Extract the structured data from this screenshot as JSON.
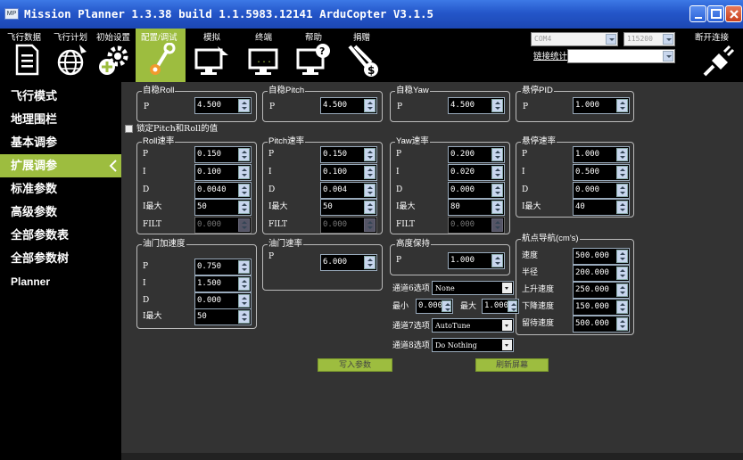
{
  "window": {
    "title": "Mission Planner 1.3.38 build 1.1.5983.12141 ArduCopter V3.1.5",
    "icon_label": "MP"
  },
  "toolbar": {
    "items": [
      {
        "label": "飞行数据",
        "icon": "flight-data-icon"
      },
      {
        "label": "飞行计划",
        "icon": "flight-plan-icon"
      },
      {
        "label": "初始设置",
        "icon": "initial-setup-icon"
      },
      {
        "label": "配置/调试",
        "icon": "config-tuning-icon"
      },
      {
        "label": "模拟",
        "icon": "simulation-icon"
      },
      {
        "label": "终端",
        "icon": "terminal-icon"
      },
      {
        "label": "帮助",
        "icon": "help-icon"
      },
      {
        "label": "捐赠",
        "icon": "donate-icon"
      }
    ],
    "port": "COM4",
    "baud": "115200",
    "link_stats": "链接统计",
    "connect_label": "断开连接"
  },
  "sidebar": {
    "items": [
      "飞行模式",
      "地理围栏",
      "基本调参",
      "扩展调参",
      "标准参数",
      "高级参数",
      "全部参数表",
      "全部参数树",
      "Planner"
    ],
    "active_index": 3
  },
  "groups": {
    "stab_roll": {
      "title": "自稳Roll",
      "p_label": "P",
      "p": "4.500"
    },
    "stab_pitch": {
      "title": "自稳Pitch",
      "p_label": "P",
      "p": "4.500"
    },
    "stab_yaw": {
      "title": "自稳Yaw",
      "p_label": "P",
      "p": "4.500"
    },
    "loiter_pid": {
      "title": "悬停PID",
      "p_label": "P",
      "p": "1.000"
    },
    "lock_checkbox": "锁定Pitch和Roll的值",
    "rate_roll": {
      "title": "Roll速率",
      "labels": [
        "P",
        "I",
        "D",
        "I最大",
        "FILT"
      ],
      "values": [
        "0.150",
        "0.100",
        "0.0040",
        "50",
        "0.000"
      ]
    },
    "rate_pitch": {
      "title": "Pitch速率",
      "labels": [
        "P",
        "I",
        "D",
        "I最大",
        "FILT"
      ],
      "values": [
        "0.150",
        "0.100",
        "0.004",
        "50",
        "0.000"
      ]
    },
    "rate_yaw": {
      "title": "Yaw速率",
      "labels": [
        "P",
        "I",
        "D",
        "I最大",
        "FILT"
      ],
      "values": [
        "0.200",
        "0.020",
        "0.000",
        "80",
        "0.000"
      ]
    },
    "loiter_rate": {
      "title": "悬停速率",
      "labels": [
        "P",
        "I",
        "D",
        "I最大"
      ],
      "values": [
        "1.000",
        "0.500",
        "0.000",
        "40"
      ]
    },
    "throttle_accel": {
      "title": "油门加速度",
      "labels": [
        "P",
        "I",
        "D",
        "I最大"
      ],
      "values": [
        "0.750",
        "1.500",
        "0.000",
        "50"
      ]
    },
    "throttle_rate": {
      "title": "油门速率",
      "p_label": "P",
      "p": "6.000"
    },
    "alt_hold": {
      "title": "高度保持",
      "p_label": "P",
      "p": "1.000"
    },
    "wpnav": {
      "title": "航点导航(cm's)",
      "labels": [
        "速度",
        "半径",
        "上升速度",
        "下降速度",
        "留待速度"
      ],
      "values": [
        "500.000",
        "200.000",
        "250.000",
        "150.000",
        "500.000"
      ]
    },
    "ch6": {
      "label": "通道6选项",
      "value": "None"
    },
    "minmax": {
      "min_label": "最小",
      "min": "0.000",
      "max_label": "最大",
      "max": "1.000"
    },
    "ch7": {
      "label": "通道7选项",
      "value": "AutoTune"
    },
    "ch8": {
      "label": "通道8选项",
      "value": "Do Nothing"
    }
  },
  "buttons": {
    "write": "写入参数",
    "refresh": "刷新屏幕"
  },
  "colors": {
    "accent": "#9dbd3f",
    "titlebar": "#2456c9",
    "panel": "#333333"
  }
}
